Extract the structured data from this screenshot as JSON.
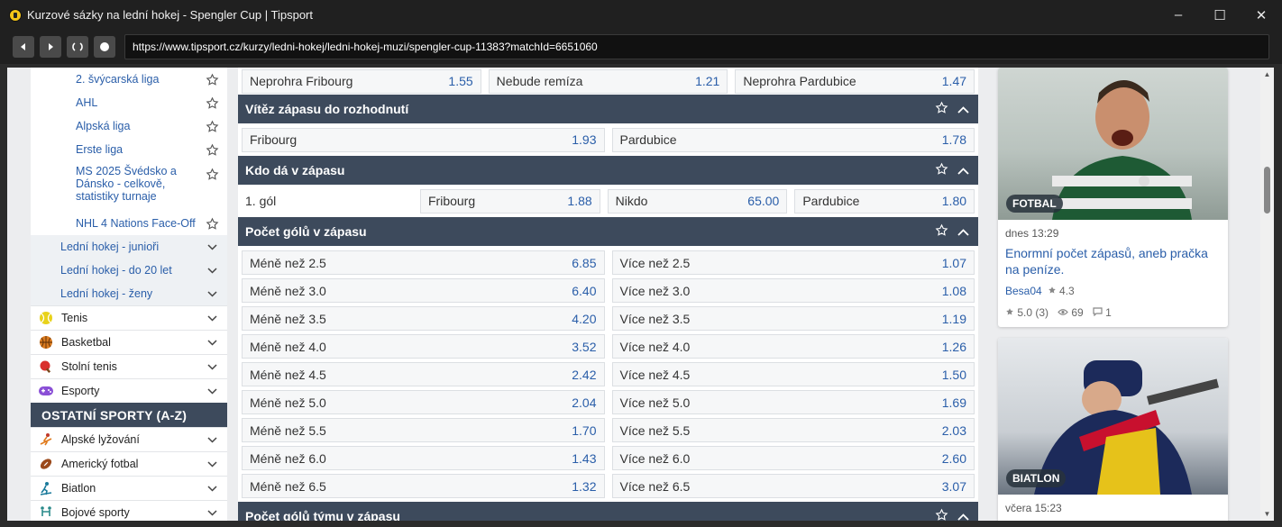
{
  "window": {
    "title": "Kurzové sázky na lední hokej - Spengler Cup | Tipsport",
    "minimize": "–",
    "maximize": "☐",
    "close": "✕"
  },
  "browser": {
    "url": "https://www.tipsport.cz/kurzy/ledni-hokej/ledni-hokej-muzi/spengler-cup-11383?matchId=6651060"
  },
  "sidebar": {
    "leagues": [
      {
        "label": "2. švýcarská liga"
      },
      {
        "label": "AHL"
      },
      {
        "label": "Alpská liga"
      },
      {
        "label": "Erste liga"
      },
      {
        "label": "MS 2025 Švédsko a Dánsko - celkově, statistiky turnaje"
      },
      {
        "label": "NHL 4 Nations Face-Off"
      }
    ],
    "groups": [
      {
        "label": "Lední hokej - junioři"
      },
      {
        "label": "Lední hokej - do 20 let"
      },
      {
        "label": "Lední hokej - ženy"
      }
    ],
    "sports": [
      {
        "label": "Tenis",
        "icon": "tennis-ball-icon"
      },
      {
        "label": "Basketbal",
        "icon": "basketball-icon"
      },
      {
        "label": "Stolní tenis",
        "icon": "table-tennis-icon"
      },
      {
        "label": "Esporty",
        "icon": "gamepad-icon"
      }
    ],
    "other_header": "OSTATNÍ SPORTY (A-Z)",
    "other_sports": [
      {
        "label": "Alpské lyžování",
        "icon": "skiing-icon"
      },
      {
        "label": "Americký fotbal",
        "icon": "american-football-icon"
      },
      {
        "label": "Biatlon",
        "icon": "biathlon-icon"
      },
      {
        "label": "Bojové sporty",
        "icon": "combat-sports-icon"
      }
    ]
  },
  "main": {
    "top_row": [
      {
        "label": "Neprohra Fribourg",
        "odd": "1.55"
      },
      {
        "label": "Nebude remíza",
        "odd": "1.21"
      },
      {
        "label": "Neprohra Pardubice",
        "odd": "1.47"
      }
    ],
    "sections": {
      "winner": {
        "title": "Vítěz zápasu do rozhodnutí",
        "odds": [
          {
            "label": "Fribourg",
            "odd": "1.93"
          },
          {
            "label": "Pardubice",
            "odd": "1.78"
          }
        ]
      },
      "scorer": {
        "title": "Kdo dá v zápasu",
        "row_label": "1. gól",
        "odds": [
          {
            "label": "Fribourg",
            "odd": "1.88"
          },
          {
            "label": "Nikdo",
            "odd": "65.00"
          },
          {
            "label": "Pardubice",
            "odd": "1.80"
          }
        ]
      },
      "goals": {
        "title": "Počet gólů v zápasu",
        "rows": [
          {
            "under": "Méně než 2.5",
            "under_odd": "6.85",
            "over": "Více než 2.5",
            "over_odd": "1.07"
          },
          {
            "under": "Méně než 3.0",
            "under_odd": "6.40",
            "over": "Více než 3.0",
            "over_odd": "1.08"
          },
          {
            "under": "Méně než 3.5",
            "under_odd": "4.20",
            "over": "Více než 3.5",
            "over_odd": "1.19"
          },
          {
            "under": "Méně než 4.0",
            "under_odd": "3.52",
            "over": "Více než 4.0",
            "over_odd": "1.26"
          },
          {
            "under": "Méně než 4.5",
            "under_odd": "2.42",
            "over": "Více než 4.5",
            "over_odd": "1.50"
          },
          {
            "under": "Méně než 5.0",
            "under_odd": "2.04",
            "over": "Více než 5.0",
            "over_odd": "1.69"
          },
          {
            "under": "Méně než 5.5",
            "under_odd": "1.70",
            "over": "Více než 5.5",
            "over_odd": "2.03"
          },
          {
            "under": "Méně než 6.0",
            "under_odd": "1.43",
            "over": "Více než 6.0",
            "over_odd": "2.60"
          },
          {
            "under": "Méně než 6.5",
            "under_odd": "1.32",
            "over": "Více než 6.5",
            "over_odd": "3.07"
          }
        ]
      },
      "team_goals": {
        "title": "Počet gólů týmu v zápasu"
      }
    }
  },
  "articles": [
    {
      "badge": "FOTBAL",
      "time": "dnes 13:29",
      "title": "Enormní počet zápasů, aneb pračka na peníze.",
      "author": "Besa04",
      "author_rating": "4.3",
      "rating": "5.0 (3)",
      "views": "69",
      "comments": "1"
    },
    {
      "badge": "BIATLON",
      "time": "včera 15:23"
    }
  ],
  "colors": {
    "header_bg": "#3d4a5c",
    "link": "#2a5ea9",
    "odd_bg": "#f6f7f8"
  }
}
